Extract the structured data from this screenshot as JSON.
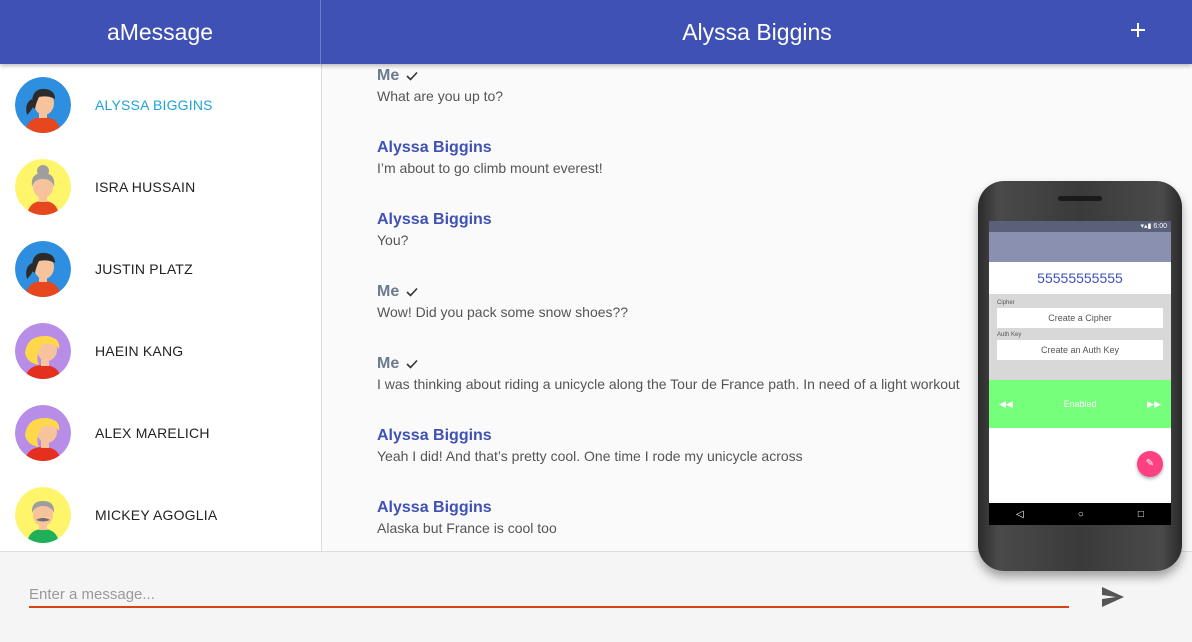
{
  "app": {
    "title": "aMessage",
    "conversation_title": "Alyssa Biggins"
  },
  "colors": {
    "primary": "#3f51b5",
    "active_contact": "#1ea2d8",
    "input_underline": "#d84315",
    "fab": "#ff4081",
    "enabled_bar": "#76ff7a"
  },
  "contacts": [
    {
      "name": "ALYSSA BIGGINS",
      "active": true,
      "avatar": "woman-ponytail-icon"
    },
    {
      "name": "ISRA HUSSAIN",
      "active": false,
      "avatar": "elderly-woman-icon"
    },
    {
      "name": "JUSTIN PLATZ",
      "active": false,
      "avatar": "woman-ponytail-icon"
    },
    {
      "name": "HAEIN KANG",
      "active": false,
      "avatar": "blonde-woman-icon"
    },
    {
      "name": "ALEX MARELICH",
      "active": false,
      "avatar": "blonde-woman-icon"
    },
    {
      "name": "MICKEY AGOGLIA",
      "active": false,
      "avatar": "man-mustache-icon"
    }
  ],
  "messages": [
    {
      "sender": "Me",
      "is_me": true,
      "text": "What are you up to?"
    },
    {
      "sender": "Alyssa Biggins",
      "is_me": false,
      "text": "I’m about to go climb mount everest!"
    },
    {
      "sender": "Alyssa Biggins",
      "is_me": false,
      "text": "You?"
    },
    {
      "sender": "Me",
      "is_me": true,
      "text": "Wow! Did you pack some snow shoes??"
    },
    {
      "sender": "Me",
      "is_me": true,
      "text": "I was thinking about riding a unicycle along the Tour de France path. In need of a light workout"
    },
    {
      "sender": "Alyssa Biggins",
      "is_me": false,
      "text": "Yeah I did! And that’s pretty cool. One time I rode my unicycle across"
    },
    {
      "sender": "Alyssa Biggins",
      "is_me": false,
      "text": "Alaska but France is cool too"
    }
  ],
  "composer": {
    "placeholder": "Enter a message...",
    "value": ""
  },
  "phone": {
    "status_time": "6:00",
    "number": "55555555555",
    "cipher_label": "Cipher",
    "cipher_placeholder": "Create a Cipher",
    "auth_label": "Auth Key",
    "auth_placeholder": "Create an Auth Key",
    "enabled_label": "Enabled",
    "rewind_glyph": "◀◀",
    "forward_glyph": "▶▶",
    "fab_glyph": "✎",
    "nav_back": "◁",
    "nav_home": "○",
    "nav_recent": "□"
  }
}
